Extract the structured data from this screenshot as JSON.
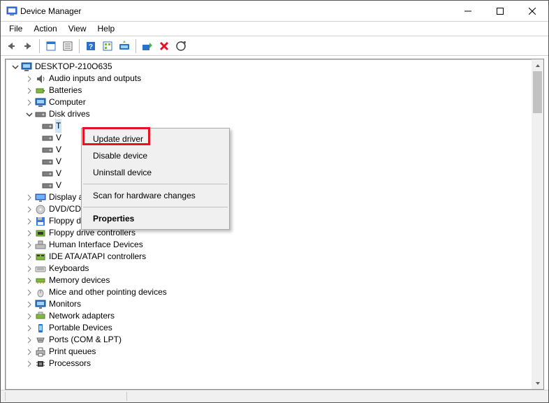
{
  "window": {
    "title": "Device Manager"
  },
  "menus": {
    "file": "File",
    "action": "Action",
    "view": "View",
    "help": "Help"
  },
  "tree": {
    "root": "DESKTOP-210O635",
    "items": [
      {
        "label": "Audio inputs and outputs"
      },
      {
        "label": "Batteries"
      },
      {
        "label": "Computer"
      },
      {
        "label": "Disk drives"
      },
      {
        "label": "Display adapters"
      },
      {
        "label": "DVD/CD-ROM drives"
      },
      {
        "label": "Floppy disk drives"
      },
      {
        "label": "Floppy drive controllers"
      },
      {
        "label": "Human Interface Devices"
      },
      {
        "label": "IDE ATA/ATAPI controllers"
      },
      {
        "label": "Keyboards"
      },
      {
        "label": "Memory devices"
      },
      {
        "label": "Mice and other pointing devices"
      },
      {
        "label": "Monitors"
      },
      {
        "label": "Network adapters"
      },
      {
        "label": "Portable Devices"
      },
      {
        "label": "Ports (COM & LPT)"
      },
      {
        "label": "Print queues"
      },
      {
        "label": "Processors"
      }
    ],
    "diskDrives": [
      {
        "label": "T"
      },
      {
        "label": "V"
      },
      {
        "label": "V"
      },
      {
        "label": "V"
      },
      {
        "label": "V"
      },
      {
        "label": "V"
      }
    ]
  },
  "contextMenu": {
    "updateDriver": "Update driver",
    "disableDevice": "Disable device",
    "uninstallDevice": "Uninstall device",
    "scanForHardware": "Scan for hardware changes",
    "properties": "Properties"
  }
}
